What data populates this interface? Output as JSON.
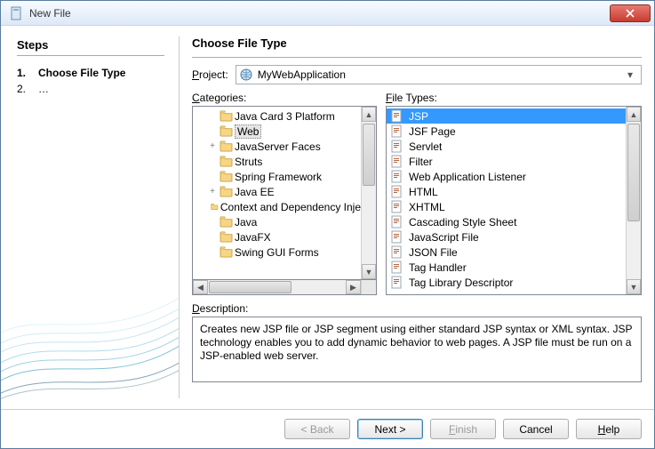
{
  "window": {
    "title": "New File"
  },
  "sidebar": {
    "heading": "Steps",
    "items": [
      {
        "num": "1.",
        "label": "Choose File Type",
        "active": true
      },
      {
        "num": "2.",
        "label": "…",
        "active": false
      }
    ]
  },
  "main": {
    "heading": "Choose File Type",
    "project_label": "Project:",
    "project_value": "MyWebApplication",
    "categories_label": "Categories:",
    "filetypes_label": "File Types:",
    "description_label": "Description:",
    "description_text": "Creates new JSP file or JSP segment using either standard JSP syntax or XML syntax. JSP technology enables you to add dynamic behavior to web pages. A JSP file must be run on a JSP-enabled web server."
  },
  "categories": [
    {
      "label": "Java Card 3 Platform",
      "level": 1,
      "exp": ""
    },
    {
      "label": "Web",
      "level": 1,
      "exp": "",
      "selected": true
    },
    {
      "label": "JavaServer Faces",
      "level": 1,
      "exp": "+"
    },
    {
      "label": "Struts",
      "level": 1,
      "exp": ""
    },
    {
      "label": "Spring Framework",
      "level": 1,
      "exp": ""
    },
    {
      "label": "Java EE",
      "level": 1,
      "exp": "+"
    },
    {
      "label": "Context and Dependency Inje",
      "level": 1,
      "exp": ""
    },
    {
      "label": "Java",
      "level": 1,
      "exp": ""
    },
    {
      "label": "JavaFX",
      "level": 1,
      "exp": ""
    },
    {
      "label": "Swing GUI Forms",
      "level": 1,
      "exp": ""
    }
  ],
  "filetypes": [
    {
      "label": "JSP",
      "selected": true
    },
    {
      "label": "JSF Page"
    },
    {
      "label": "Servlet"
    },
    {
      "label": "Filter"
    },
    {
      "label": "Web Application Listener"
    },
    {
      "label": "HTML"
    },
    {
      "label": "XHTML"
    },
    {
      "label": "Cascading Style Sheet"
    },
    {
      "label": "JavaScript File"
    },
    {
      "label": "JSON File"
    },
    {
      "label": "Tag Handler"
    },
    {
      "label": "Tag Library Descriptor"
    }
  ],
  "buttons": {
    "back": "< Back",
    "next": "Next >",
    "finish": "Finish",
    "cancel": "Cancel",
    "help": "Help"
  }
}
